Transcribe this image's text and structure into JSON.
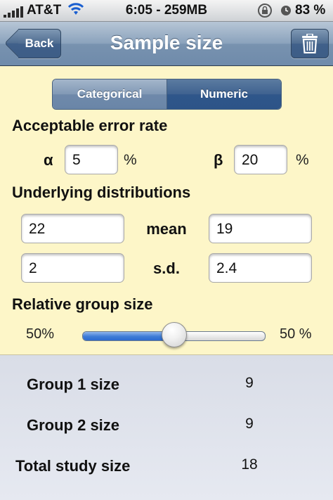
{
  "status_bar": {
    "carrier": "AT&T",
    "time": "6:05 - 259MB",
    "battery": "83 %"
  },
  "nav": {
    "back_label": "Back",
    "title": "Sample size",
    "trash_icon": "trash-icon"
  },
  "segments": {
    "categorical": "Categorical",
    "numeric": "Numeric",
    "selected": "Numeric"
  },
  "error_rate": {
    "heading": "Acceptable error rate",
    "alpha_symbol": "α",
    "alpha_value": "5",
    "beta_symbol": "β",
    "beta_value": "20",
    "percent_sign": "%"
  },
  "distributions": {
    "heading": "Underlying distributions",
    "mean_label": "mean",
    "sd_label": "s.d.",
    "group1_mean": "22",
    "group2_mean": "19",
    "group1_sd": "2",
    "group2_sd": "2.4"
  },
  "group_size": {
    "heading": "Relative group size",
    "left_value": "50%",
    "right_value": "50 %",
    "slider_fraction": 0.5
  },
  "results": {
    "group1_label": "Group 1 size",
    "group1_value": "9",
    "group2_label": "Group 2 size",
    "group2_value": "9",
    "total_label": "Total study size",
    "total_value": "18"
  },
  "colors": {
    "input_background": "#fdf6c8",
    "results_background": "#dfe3ec",
    "nav_bar": "#7892af",
    "slider_fill": "#3d7cd6"
  }
}
